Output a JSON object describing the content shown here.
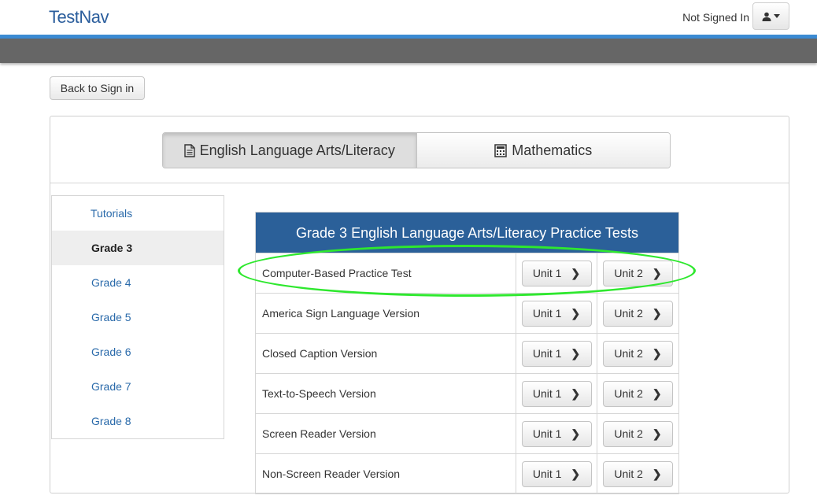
{
  "header": {
    "brand": "TestNav",
    "signed_status": "Not Signed In",
    "user_icon": "user-icon"
  },
  "back_button": "Back to Sign in",
  "subjects": [
    {
      "label": "English Language Arts/Literacy",
      "icon": "document-icon",
      "active": true
    },
    {
      "label": "Mathematics",
      "icon": "calculator-icon",
      "active": false
    }
  ],
  "sidebar": {
    "items": [
      {
        "label": "Tutorials"
      },
      {
        "label": "Grade 3",
        "active": true
      },
      {
        "label": "Grade 4"
      },
      {
        "label": "Grade 5"
      },
      {
        "label": "Grade 6"
      },
      {
        "label": "Grade 7"
      },
      {
        "label": "Grade 8"
      }
    ]
  },
  "tests": {
    "title": "Grade 3 English Language Arts/Literacy Practice Tests",
    "unit1_label": "Unit 1",
    "unit2_label": "Unit 2",
    "rows": [
      {
        "name": "Computer-Based Practice Test"
      },
      {
        "name": "America Sign Language Version"
      },
      {
        "name": "Closed Caption Version"
      },
      {
        "name": "Text-to-Speech Version"
      },
      {
        "name": "Screen Reader Version"
      },
      {
        "name": "Non-Screen Reader Version"
      }
    ]
  },
  "colors": {
    "brand": "#2a5d9c",
    "accent_line": "#3b8bd3",
    "table_header": "#2b6099",
    "highlight": "#2ee82e"
  }
}
